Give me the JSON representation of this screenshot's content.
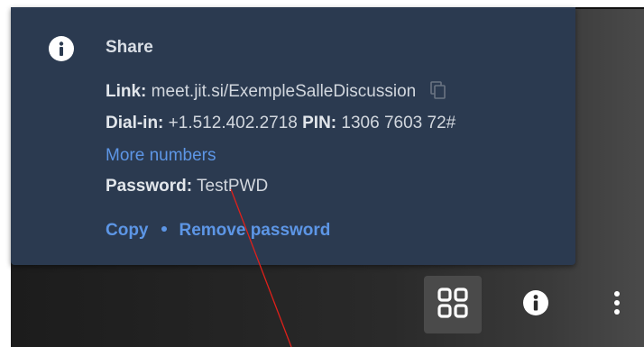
{
  "dialog": {
    "title": "Share",
    "link": {
      "label": "Link:",
      "value": "meet.jit.si/ExempleSalleDiscussion"
    },
    "dial_in": {
      "label": "Dial-in:",
      "number": "+1.512.402.2718",
      "pin_label": "PIN:",
      "pin": "1306 7603 72#"
    },
    "more_numbers": "More numbers",
    "password": {
      "label": "Password:",
      "value": "TestPWD"
    },
    "actions": {
      "copy": "Copy",
      "remove_password": "Remove password"
    }
  },
  "icons": {
    "info_badge": "info-icon",
    "copy": "copy-icon",
    "tile_view": "tile-view-icon",
    "toolbar_info": "info-icon",
    "more": "more-vertical-icon"
  },
  "colors": {
    "dialog_bg": "#2b3a50",
    "link_blue": "#5d96e6",
    "annotation": "#e0201a"
  }
}
